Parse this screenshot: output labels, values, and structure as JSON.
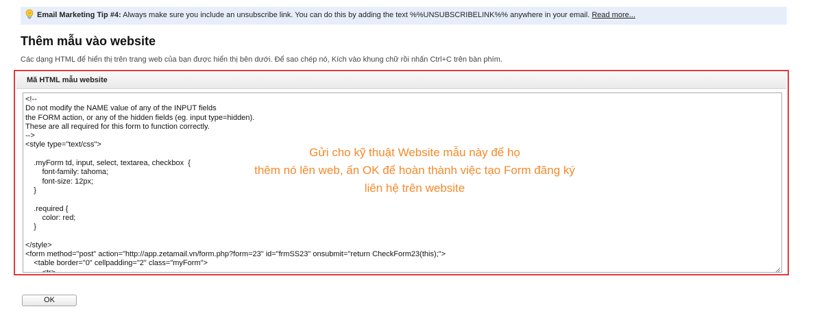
{
  "tip": {
    "icon": "lightbulb-icon",
    "title": "Email Marketing Tip #4:",
    "text": " Always make sure you include an unsubscribe link. You can do this by adding the text %%UNSUBSCRIBELINK%% anywhere in your email. ",
    "link": "Read more..."
  },
  "page": {
    "title": "Thêm mẫu vào website",
    "description": "Các dạng HTML để hiển thị trên trang web của bạn được hiển thị bên dưới. Để sao chép nó, Kích vào khung chữ rồi nhấn Ctrl+C trên bàn phím."
  },
  "panel": {
    "header": "Mã HTML mẫu website",
    "code": "<!--\nDo not modify the NAME value of any of the INPUT fields\nthe FORM action, or any of the hidden fields (eg. input type=hidden).\nThese are all required for this form to function correctly.\n-->\n<style type=\"text/css\">\n\n\t.myForm td, input, select, textarea, checkbox  {\n\t\tfont-family: tahoma;\n\t\tfont-size: 12px;\n\t}\n\n\t.required {\n\t\tcolor: red;\n\t}\n\n</style>\n<form method=\"post\" action=\"http://app.zetamail.vn/form.php?form=23\" id=\"frmSS23\" onsubmit=\"return CheckForm23(this);\">\n\t<table border=\"0\" cellpadding=\"2\" class=\"myForm\">\n\t\t<tr>"
  },
  "annotation": {
    "lines": [
      "Gửi cho kỹ thuật Website mẫu này để họ",
      "thêm nó lên web, ấn OK để hoàn thành việc tạo Form đăng ký",
      "liên hệ trên website"
    ],
    "color": "#f5892a"
  },
  "actions": {
    "ok_label": "OK"
  },
  "colors": {
    "tip_background": "#e7eefa",
    "highlight_border": "#e0393c"
  }
}
